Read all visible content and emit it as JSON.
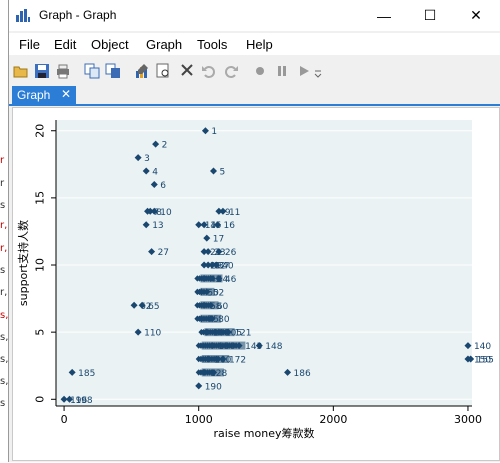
{
  "window": {
    "title": "Graph - Graph",
    "controls": {
      "minimize": "—",
      "maximize": "☐",
      "close": "✕"
    }
  },
  "menu": [
    "File",
    "Edit",
    "Object",
    "Graph",
    "Tools",
    "Help"
  ],
  "toolbar_icons": [
    "open-icon",
    "save-icon",
    "print-icon",
    "copy-icon",
    "copy-graph-icon",
    "graph-editor-icon",
    "preview-icon",
    "pointer-icon",
    "undo-icon",
    "redo-icon",
    "record-icon",
    "pause-icon",
    "play-icon",
    "dropdown-icon"
  ],
  "tab": {
    "label": "Graph",
    "close": "✕"
  },
  "chart_data": {
    "type": "scatter",
    "xlabel": "raise money筹款数",
    "ylabel": "support支持人数",
    "xlim": [
      -60,
      3030
    ],
    "ylim": [
      -0.5,
      20.8
    ],
    "xticks": [
      0,
      1000,
      2000,
      3000
    ],
    "yticks": [
      0,
      5,
      10,
      15,
      20
    ],
    "grid": "horizontal",
    "marker_color": "#1a476f",
    "points": [
      {
        "x": 1050,
        "y": 20,
        "label": "1"
      },
      {
        "x": 680,
        "y": 19,
        "label": "2"
      },
      {
        "x": 550,
        "y": 18,
        "label": "3"
      },
      {
        "x": 610,
        "y": 17,
        "label": "4"
      },
      {
        "x": 1110,
        "y": 17,
        "label": "5"
      },
      {
        "x": 670,
        "y": 16,
        "label": "6"
      },
      {
        "x": 620,
        "y": 14,
        "label": "7"
      },
      {
        "x": 640,
        "y": 14,
        "label": "8"
      },
      {
        "x": 670,
        "y": 14,
        "label": "10"
      },
      {
        "x": 1150,
        "y": 14,
        "label": "9"
      },
      {
        "x": 1180,
        "y": 14,
        "label": "11"
      },
      {
        "x": 610,
        "y": 13,
        "label": "13"
      },
      {
        "x": 1000,
        "y": 13,
        "label": "14"
      },
      {
        "x": 1040,
        "y": 13,
        "label": "15"
      },
      {
        "x": 1140,
        "y": 13,
        "label": "16"
      },
      {
        "x": 1060,
        "y": 12,
        "label": "17"
      },
      {
        "x": 650,
        "y": 11,
        "label": "27"
      },
      {
        "x": 1040,
        "y": 11,
        "label": "21"
      },
      {
        "x": 1070,
        "y": 11,
        "label": "23"
      },
      {
        "x": 1150,
        "y": 11,
        "label": "26"
      },
      {
        "x": 1040,
        "y": 10,
        "label": "29"
      },
      {
        "x": 1070,
        "y": 10,
        "label": "32"
      },
      {
        "x": 1100,
        "y": 10,
        "label": "37"
      },
      {
        "x": 1130,
        "y": 10,
        "label": "40"
      },
      {
        "x": 1040,
        "y": 9,
        "label": "42"
      },
      {
        "x": 1090,
        "y": 9,
        "label": "44"
      },
      {
        "x": 1150,
        "y": 9,
        "label": "46"
      },
      {
        "x": 1020,
        "y": 8,
        "label": "50"
      },
      {
        "x": 1060,
        "y": 8,
        "label": "52"
      },
      {
        "x": 520,
        "y": 7,
        "label": "62"
      },
      {
        "x": 580,
        "y": 7,
        "label": "65"
      },
      {
        "x": 1040,
        "y": 7,
        "label": "58"
      },
      {
        "x": 1090,
        "y": 7,
        "label": "60"
      },
      {
        "x": 1020,
        "y": 6,
        "label": "75"
      },
      {
        "x": 1100,
        "y": 6,
        "label": "80"
      },
      {
        "x": 550,
        "y": 5,
        "label": "110"
      },
      {
        "x": 1060,
        "y": 5,
        "label": "100"
      },
      {
        "x": 1150,
        "y": 5,
        "label": "105"
      },
      {
        "x": 1220,
        "y": 5,
        "label": "121"
      },
      {
        "x": 1100,
        "y": 4,
        "label": "130"
      },
      {
        "x": 1300,
        "y": 4,
        "label": "143"
      },
      {
        "x": 1450,
        "y": 4,
        "label": "148"
      },
      {
        "x": 3000,
        "y": 4,
        "label": "140"
      },
      {
        "x": 1070,
        "y": 3,
        "label": "160"
      },
      {
        "x": 1180,
        "y": 3,
        "label": "172"
      },
      {
        "x": 3000,
        "y": 3,
        "label": "150"
      },
      {
        "x": 3020,
        "y": 3,
        "label": "155"
      },
      {
        "x": 60,
        "y": 2,
        "label": "185"
      },
      {
        "x": 1040,
        "y": 2,
        "label": "128"
      },
      {
        "x": 1660,
        "y": 2,
        "label": "186"
      },
      {
        "x": 1000,
        "y": 1,
        "label": "190"
      },
      {
        "x": 0,
        "y": 0,
        "label": "196"
      },
      {
        "x": 40,
        "y": 0,
        "label": "198"
      }
    ],
    "dense_rows": [
      {
        "y": 9,
        "x0": 990,
        "x1": 1110
      },
      {
        "y": 8,
        "x0": 990,
        "x1": 1050
      },
      {
        "y": 7,
        "x0": 990,
        "x1": 1080
      },
      {
        "y": 6,
        "x0": 990,
        "x1": 1100
      },
      {
        "y": 5,
        "x0": 1020,
        "x1": 1200
      },
      {
        "y": 4,
        "x0": 1000,
        "x1": 1280
      },
      {
        "y": 3,
        "x0": 1000,
        "x1": 1160
      },
      {
        "y": 2,
        "x0": 1000,
        "x1": 1120
      }
    ]
  }
}
